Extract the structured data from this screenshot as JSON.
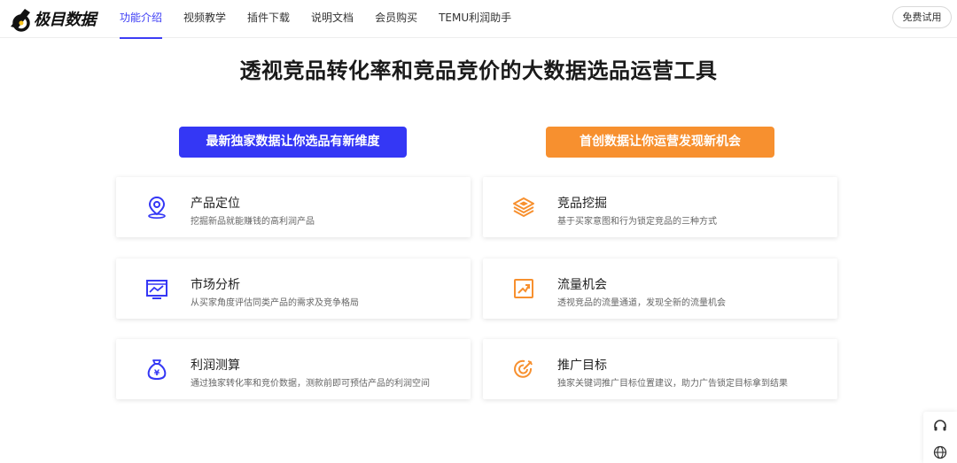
{
  "brand": {
    "name": "极目数据"
  },
  "nav": {
    "items": [
      {
        "label": "功能介绍",
        "active": true
      },
      {
        "label": "视频教学",
        "active": false
      },
      {
        "label": "插件下载",
        "active": false
      },
      {
        "label": "说明文档",
        "active": false
      },
      {
        "label": "会员购买",
        "active": false
      },
      {
        "label": "TEMU利润助手",
        "active": false
      }
    ],
    "trial_label": "免费试用"
  },
  "hero": {
    "headline": "透视竞品转化率和竞品竞价的大数据选品运营工具",
    "cta_left": "最新独家数据让你选品有新维度",
    "cta_right": "首创数据让你运营发现新机会"
  },
  "colors": {
    "accent_blue": "#3437f5",
    "accent_orange": "#f7902f"
  },
  "features": [
    {
      "title": "产品定位",
      "desc": "挖掘新品就能赚钱的高利润产品",
      "icon": "location-pin-icon"
    },
    {
      "title": "竞品挖掘",
      "desc": "基于买家意图和行为锁定竞品的三种方式",
      "icon": "layers-icon"
    },
    {
      "title": "市场分析",
      "desc": "从买家角度评估同类产品的需求及竞争格局",
      "icon": "analytics-screen-icon"
    },
    {
      "title": "流量机会",
      "desc": "透视竞品的流量通道，发现全新的流量机会",
      "icon": "trend-up-icon"
    },
    {
      "title": "利润测算",
      "desc": "通过独家转化率和竞价数据，测款前即可预估产品的利润空间",
      "icon": "money-bag-icon"
    },
    {
      "title": "推广目标",
      "desc": "独家关键词推广目标位置建议，助力广告锁定目标拿到结果",
      "icon": "target-icon"
    }
  ],
  "side_tools": [
    {
      "icon": "headset-icon"
    },
    {
      "icon": "globe-icon"
    }
  ]
}
